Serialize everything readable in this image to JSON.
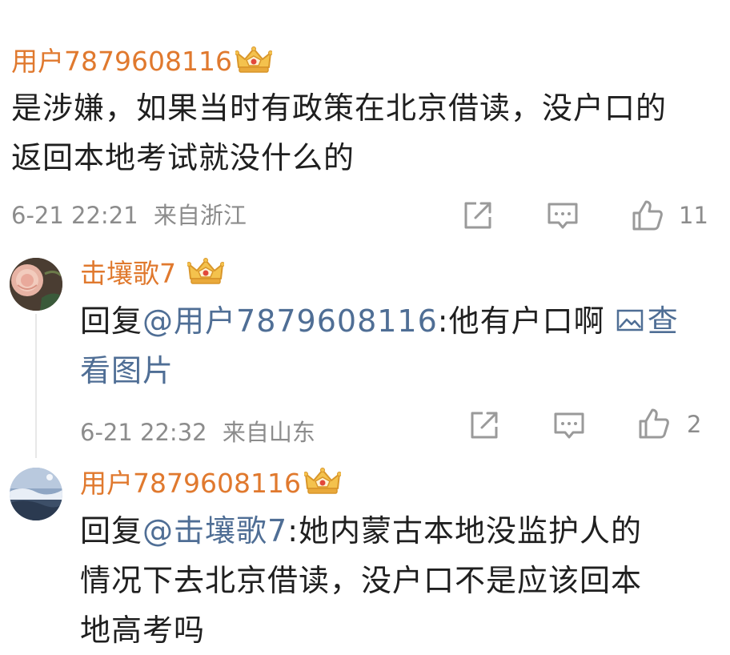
{
  "comments": [
    {
      "username": "用户7879608116",
      "badge_icon": "crown-badge-icon",
      "text_lines": [
        "是涉嫌，如果当时有政策在北京借读，没户口的",
        "返回本地考试就没什么的"
      ],
      "timestamp": "6-21 22:21",
      "location": "来自浙江",
      "like_count": "11"
    },
    {
      "username": "击壤歌7",
      "badge_icon": "crown-badge-icon",
      "reply_prefix": "回复",
      "mention": "@用户7879608116",
      "text": ":他有户口啊 ",
      "view_image": "查看图片",
      "timestamp": "6-21 22:32",
      "location": "来自山东",
      "like_count": "2"
    },
    {
      "username": "用户7879608116",
      "badge_icon": "crown-badge-icon",
      "reply_prefix": "回复",
      "mention": "@击壤歌7",
      "text_line1": ":她内蒙古本地没监护人的",
      "text_line2": "情况下去北京借读，没户口不是应该回本",
      "text_line3": "地高考吗"
    }
  ],
  "colors": {
    "username": "#e0792e",
    "mention": "#4f6e95",
    "meta": "#8c8c8c",
    "text": "#1f1f1f"
  }
}
